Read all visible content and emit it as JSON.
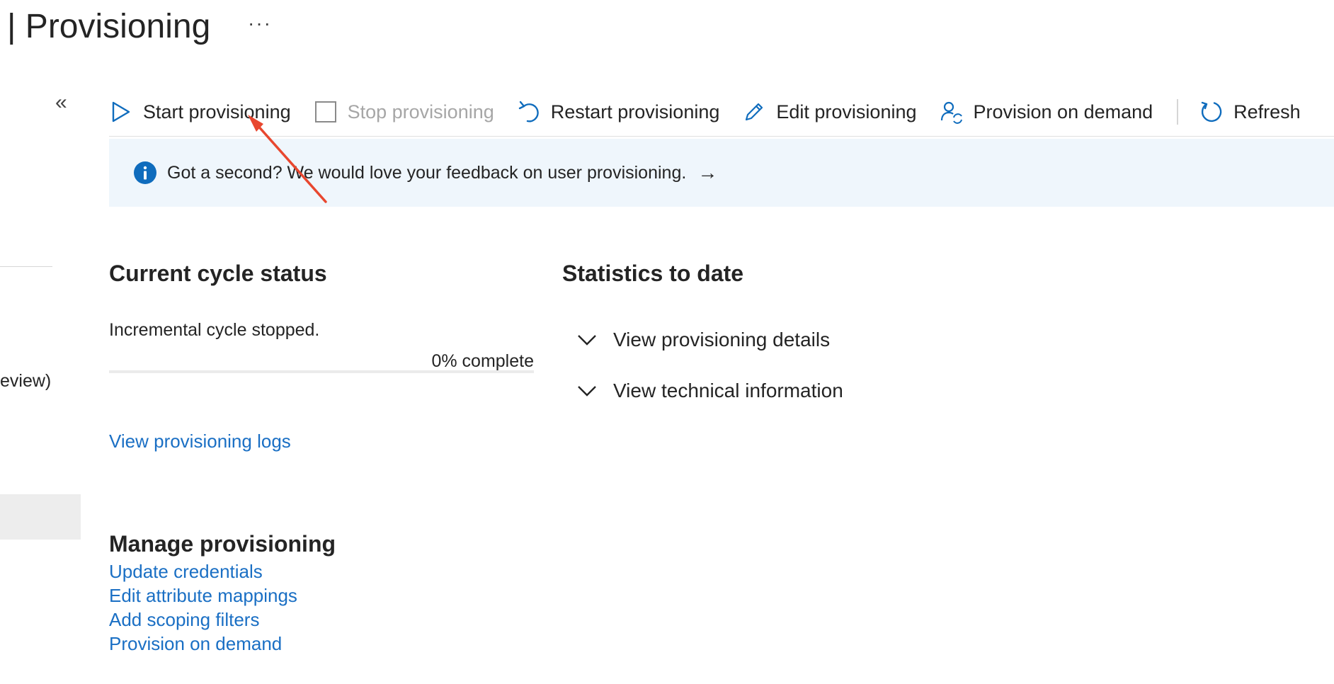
{
  "header": {
    "title": "| Provisioning",
    "more_label": "···"
  },
  "sidebar": {
    "collapse_label": "«",
    "partial_item": "eview)"
  },
  "toolbar": {
    "start": "Start provisioning",
    "stop": "Stop provisioning",
    "restart": "Restart provisioning",
    "edit": "Edit provisioning",
    "on_demand": "Provision on demand",
    "refresh": "Refresh"
  },
  "banner": {
    "text": "Got a second? We would love your feedback on user provisioning.",
    "arrow": "→"
  },
  "cycle": {
    "heading": "Current cycle status",
    "status": "Incremental cycle stopped.",
    "progress_label": "0% complete",
    "progress_percent": 0,
    "logs_link": "View provisioning logs"
  },
  "statistics": {
    "heading": "Statistics to date",
    "details_label": "View provisioning details",
    "technical_label": "View technical information"
  },
  "manage": {
    "heading": "Manage provisioning",
    "links": [
      "Update credentials",
      "Edit attribute mappings",
      "Add scoping filters",
      "Provision on demand"
    ]
  },
  "colors": {
    "accent": "#0078d4",
    "link": "#1a6fc4",
    "annotation": "#e8472f"
  }
}
